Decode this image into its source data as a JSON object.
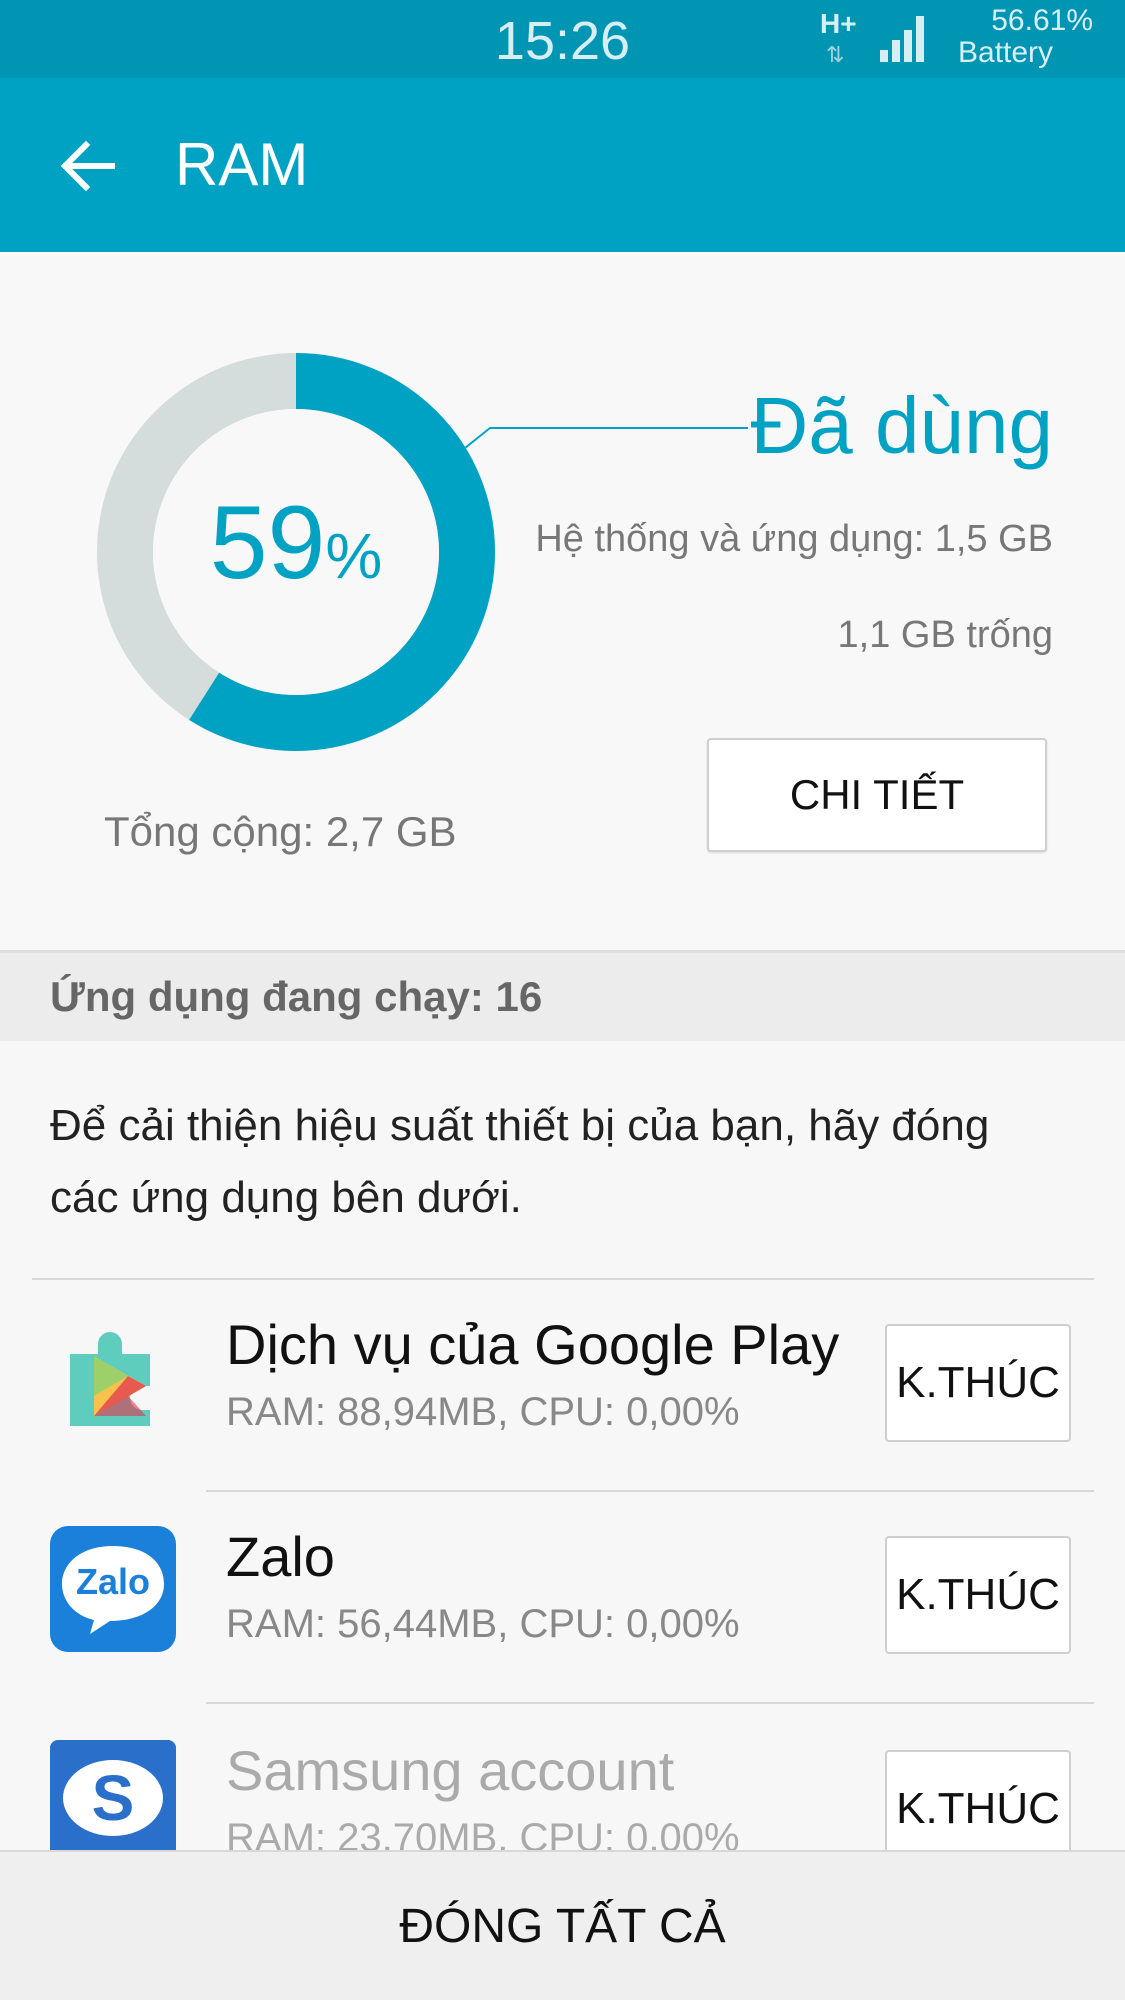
{
  "status_bar": {
    "time": "15:26",
    "network": "H+",
    "network_arrows": "⇅",
    "battery_percent": "56.61%",
    "battery_label": "Battery"
  },
  "app_bar": {
    "title": "RAM",
    "back_icon": "arrow-left-icon"
  },
  "summary": {
    "percent_value": "59",
    "percent_symbol": "%",
    "used_fraction": 0.59,
    "used_title": "Đã dùng",
    "system_and_apps": "Hệ thống và ứng dụng: 1,5 GB",
    "free": "1,1 GB trống",
    "detail_button": "CHI TIẾT",
    "total": "Tổng cộng: 2,7 GB",
    "colors": {
      "used": "#00a2c3",
      "free": "#d5dcdc",
      "accent": "#00a2c3"
    }
  },
  "running": {
    "header": "Ứng dụng đang chạy: 16",
    "hint": "Để cải thiện hiệu suất thiết bị của bạn, hãy đóng các ứng dụng bên dưới.",
    "apps": [
      {
        "name": "Dịch vụ của Google Play",
        "stats": "RAM: 88,94MB, CPU: 0,00%",
        "button": "K.THÚC",
        "icon": "google-play-services-icon"
      },
      {
        "name": "Zalo",
        "stats": "RAM: 56,44MB, CPU: 0,00%",
        "button": "K.THÚC",
        "icon": "zalo-icon",
        "icon_text": "Zalo"
      },
      {
        "name": "Samsung account",
        "stats": "RAM: 23,70MB, CPU: 0,00%",
        "button": "K.THÚC",
        "icon": "samsung-account-icon",
        "icon_text": "S"
      }
    ]
  },
  "bottom": {
    "close_all": "ĐÓNG TẤT CẢ"
  }
}
